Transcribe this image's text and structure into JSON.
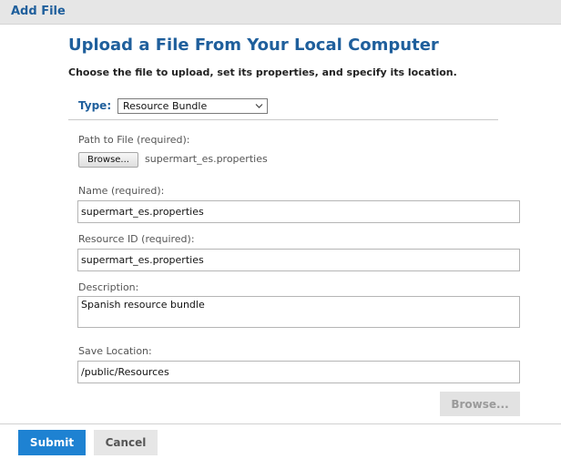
{
  "window": {
    "title": "Add File"
  },
  "dialog": {
    "heading": "Upload a File From Your Local Computer",
    "subtitle": "Choose the file to upload, set its properties, and specify its location."
  },
  "type": {
    "label": "Type:",
    "selected": "Resource Bundle",
    "chevron_icon": "chevron-down-icon"
  },
  "path": {
    "label": "Path to File (required):",
    "browse_label": "Browse...",
    "file_name": "supermart_es.properties"
  },
  "name": {
    "label": "Name (required):",
    "value": "supermart_es.properties"
  },
  "resource_id": {
    "label": "Resource ID (required):",
    "value": "supermart_es.properties"
  },
  "description": {
    "label": "Description:",
    "value": "Spanish resource bundle"
  },
  "save_location": {
    "label": "Save Location:",
    "value": "/public/Resources",
    "browse_label": "Browse..."
  },
  "footer": {
    "submit_label": "Submit",
    "cancel_label": "Cancel"
  },
  "colors": {
    "brand_blue": "#1f5f9c",
    "submit_blue": "#1e82d2",
    "disabled_gray": "#e2e2e2"
  }
}
